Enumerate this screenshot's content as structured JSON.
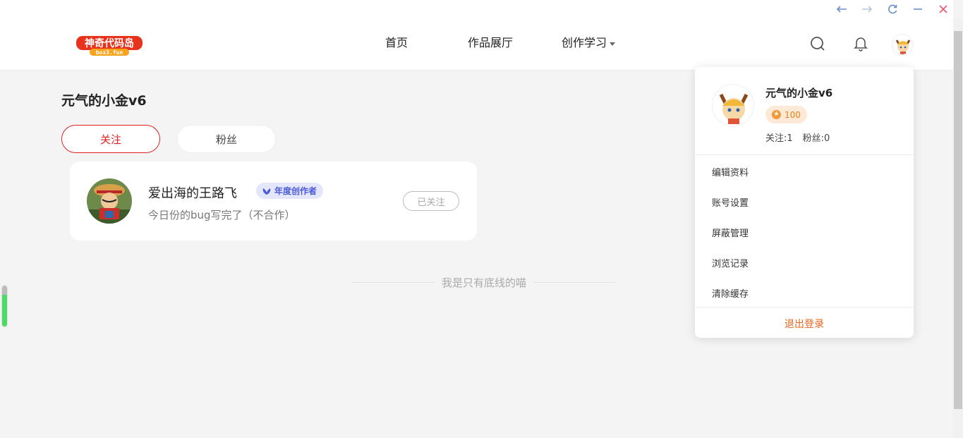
{
  "window": {
    "controls": [
      "back-arrow",
      "forward-arrow",
      "refresh",
      "minimize",
      "close"
    ]
  },
  "header": {
    "logo_text": "神奇代码岛",
    "logo_subtext": "box3.fun",
    "nav": {
      "home": "首页",
      "gallery": "作品展厅",
      "learn": "创作学习"
    },
    "icons": [
      "search-icon",
      "bell-icon",
      "avatar"
    ]
  },
  "main": {
    "page_title": "元气的小金v6",
    "tabs": {
      "follow": "关注",
      "fans": "粉丝"
    },
    "following": [
      {
        "name": "爱出海的王路飞",
        "badge": "年度创作者",
        "signature": "今日份的bug写完了（不合作）",
        "status_button": "已关注"
      }
    ],
    "end_of_list": "我是只有底线的喵"
  },
  "dropdown": {
    "name": "元气的小金v6",
    "coins": "100",
    "follow_count": "关注:1",
    "fans_count": "粉丝:0",
    "menu": {
      "edit_profile": "编辑资料",
      "account_settings": "账号设置",
      "block_manage": "屏蔽管理",
      "browse_history": "浏览记录",
      "clear_cache": "清除缓存"
    },
    "logout": "退出登录"
  },
  "colors": {
    "accent_red": "#e02020",
    "logout_orange": "#e8641e",
    "badge_blue": "#4b5bd8",
    "coin_orange": "#e8821a"
  }
}
